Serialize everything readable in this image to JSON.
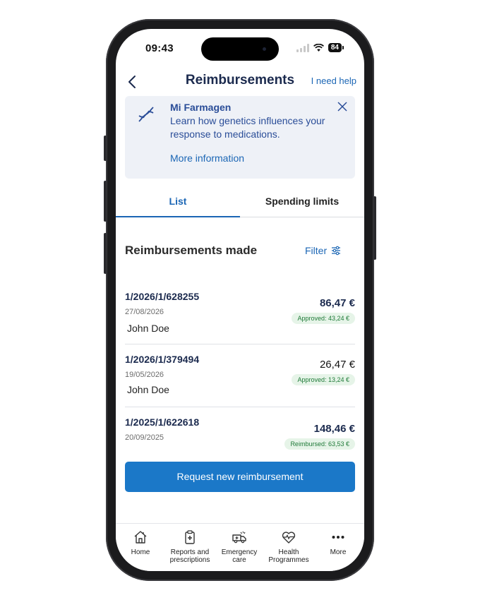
{
  "status_bar": {
    "time": "09:43",
    "battery": "84"
  },
  "header": {
    "title": "Reimbursements",
    "help_link": "I need help"
  },
  "banner": {
    "title": "Mi Farmagen",
    "text": "Learn how genetics influences your response to medications.",
    "link": "More information"
  },
  "tabs": [
    {
      "label": "List",
      "active": true
    },
    {
      "label": "Spending limits",
      "active": false
    }
  ],
  "section": {
    "title": "Reimbursements made",
    "filter_label": "Filter"
  },
  "reimbursements": [
    {
      "reference": "1/2026/1/628255",
      "date": "27/08/2026",
      "person": "John Doe",
      "amount": "86,47 €",
      "status": "Approved: 43,24 €"
    },
    {
      "reference": "1/2026/1/379494",
      "date": "19/05/2026",
      "person": "John Doe",
      "amount": "26,47 €",
      "status": "Approved: 13,24 €"
    },
    {
      "reference": "1/2025/1/622618",
      "date": "20/09/2025",
      "person": "",
      "amount": "148,46 €",
      "status": "Reimbursed: 63,53 €"
    }
  ],
  "cta_label": "Request new reimbursement",
  "nav": [
    {
      "label": "Home",
      "icon": "home-icon"
    },
    {
      "label": "Reports and prescriptions",
      "icon": "clipboard-icon"
    },
    {
      "label": "Emergency care",
      "icon": "ambulance-icon"
    },
    {
      "label": "Health Programmes",
      "icon": "heart-pulse-icon"
    },
    {
      "label": "More",
      "icon": "more-dots-icon"
    }
  ],
  "colors": {
    "primary": "#1b78c8",
    "link": "#1b66b5",
    "navy": "#1b2a4e",
    "success": "#1f7a38",
    "banner_bg": "#eef1f7"
  }
}
